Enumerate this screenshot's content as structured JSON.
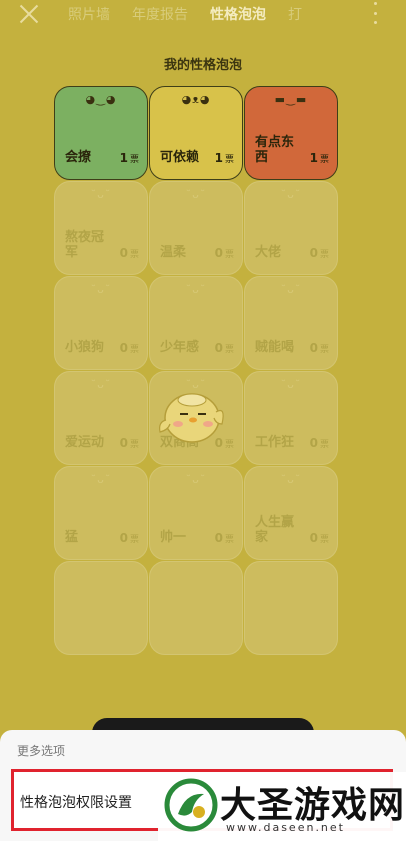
{
  "header": {
    "tabs": [
      {
        "label": "照片墙"
      },
      {
        "label": "年度报告"
      },
      {
        "label": "性格泡泡"
      },
      {
        "label": "打"
      }
    ]
  },
  "section_title": "我的性格泡泡",
  "cards": [
    {
      "name": "会撩",
      "votes": "1",
      "unit": "票",
      "face": "◕‿◕"
    },
    {
      "name": "可依赖",
      "votes": "1",
      "unit": "票",
      "face": "◕ᴥ◕"
    },
    {
      "name": "有点东西",
      "votes": "1",
      "unit": "票",
      "face": "▬‿▬"
    },
    {
      "name": "熬夜冠军",
      "votes": "0",
      "unit": "票",
      "face": "˘ᴗ˘"
    },
    {
      "name": "温柔",
      "votes": "0",
      "unit": "票",
      "face": "˘ᴗ˘"
    },
    {
      "name": "大佬",
      "votes": "0",
      "unit": "票",
      "face": "˘ᴗ˘"
    },
    {
      "name": "小狼狗",
      "votes": "0",
      "unit": "票",
      "face": "˘ᴗ˘"
    },
    {
      "name": "少年感",
      "votes": "0",
      "unit": "票",
      "face": "˘ᴗ˘"
    },
    {
      "name": "贼能喝",
      "votes": "0",
      "unit": "票",
      "face": "˘ᴗ˘"
    },
    {
      "name": "爱运动",
      "votes": "0",
      "unit": "票",
      "face": "˘ᴗ˘"
    },
    {
      "name": "双商高",
      "votes": "0",
      "unit": "票",
      "face": "˘ᴗ˘"
    },
    {
      "name": "工作狂",
      "votes": "0",
      "unit": "票",
      "face": "˘ᴗ˘"
    },
    {
      "name": "猛",
      "votes": "0",
      "unit": "票",
      "face": "˘ᴗ˘"
    },
    {
      "name": "帅一",
      "votes": "0",
      "unit": "票",
      "face": "˘ᴗ˘"
    },
    {
      "name": "人生赢家",
      "votes": "0",
      "unit": "票",
      "face": "˘ᴗ˘"
    },
    {
      "name": "",
      "votes": "",
      "unit": "",
      "face": ""
    },
    {
      "name": "",
      "votes": "",
      "unit": "",
      "face": ""
    },
    {
      "name": "",
      "votes": "",
      "unit": "",
      "face": ""
    }
  ],
  "sheet": {
    "title": "更多选项",
    "option_label": "性格泡泡权限设置"
  },
  "watermark": {
    "brand": "大圣游戏网",
    "url": "www.daseen.net"
  },
  "colors": {
    "highlight_border": "#e0232e",
    "card_green": "#7cb061",
    "card_yellow": "#d8c24a",
    "card_orange": "#d1683a"
  }
}
